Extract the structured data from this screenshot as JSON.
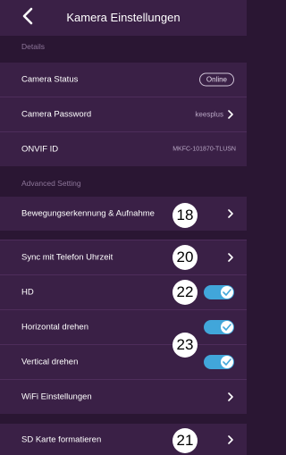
{
  "header": {
    "title": "Kamera Einstellungen"
  },
  "sections": {
    "details": "Details",
    "advanced": "Advanced Setting"
  },
  "rows": {
    "camera_status": {
      "label": "Camera Status",
      "value": "Online"
    },
    "camera_password": {
      "label": "Camera Password",
      "value": "keesplus"
    },
    "onvif_id": {
      "label": "ONVIF ID",
      "value": "MKFC-101870-TLUSN"
    },
    "motion": {
      "label": "Bewegungserkennung & Aufnahme",
      "annotation": "18"
    },
    "sync_time": {
      "label": "Sync mit Telefon Uhrzeit",
      "annotation": "20"
    },
    "hd": {
      "label": "HD",
      "annotation": "22",
      "enabled": true
    },
    "horizontal_flip": {
      "label": "Horizontal drehen",
      "enabled": true
    },
    "rotate_annotation": "23",
    "vertical_flip": {
      "label": "Vertical drehen",
      "enabled": true
    },
    "wifi": {
      "label": "WiFi Einstellungen"
    },
    "sd_format": {
      "label": "SD Karte formatieren",
      "annotation": "21"
    }
  },
  "colors": {
    "background": "#2a1633",
    "row_background": "#3a2046",
    "toggle_on": "#41a6da",
    "section_text": "#8d7699"
  },
  "icons": {
    "back": "chevron-left-icon",
    "row_arrow": "chevron-right-icon",
    "toggle_check": "check-icon"
  }
}
